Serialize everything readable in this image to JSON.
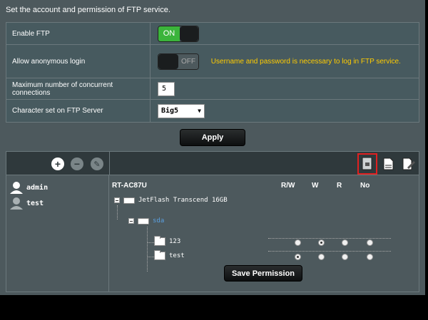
{
  "intro": "Set the account and permission of FTP service.",
  "settings": {
    "enable_ftp": {
      "label": "Enable FTP",
      "toggle": "ON"
    },
    "anonymous": {
      "label": "Allow anonymous login",
      "toggle": "OFF",
      "hint": "Username and password is necessary to log in FTP service."
    },
    "max_conn": {
      "label": "Maximum number of concurrent connections",
      "value": "5"
    },
    "charset": {
      "label": "Character set on FTP Server",
      "selected": "Big5"
    }
  },
  "apply_label": "Apply",
  "users": [
    "admin",
    "test"
  ],
  "tree": {
    "device": "RT-AC87U",
    "columns": [
      "R/W",
      "W",
      "R",
      "No"
    ],
    "drive": "JetFlash Transcend 16GB",
    "volume": "sda",
    "folders": [
      "123",
      "test"
    ]
  },
  "save_label": "Save Permission",
  "colors": {
    "accent_on": "#3bb43b",
    "hint": "#ffcc00",
    "highlight": "#e02020",
    "volume_link": "#5aa0e0"
  }
}
